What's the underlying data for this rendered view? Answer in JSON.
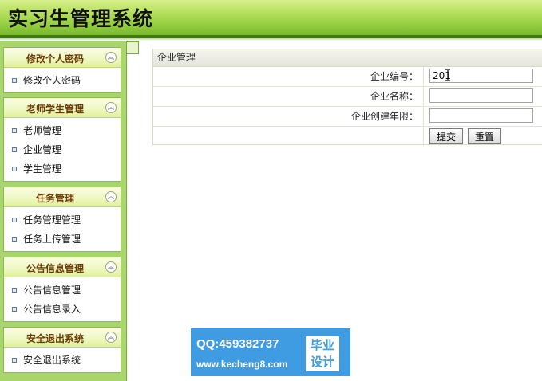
{
  "header": {
    "title": "实习生管理系统"
  },
  "sidebar": {
    "panels": [
      {
        "title": "修改个人密码",
        "items": [
          "修改个人密码"
        ]
      },
      {
        "title": "老师学生管理",
        "items": [
          "老师管理",
          "企业管理",
          "学生管理"
        ]
      },
      {
        "title": "任务管理",
        "items": [
          "任务管理管理",
          "任务上传管理"
        ]
      },
      {
        "title": "公告信息管理",
        "items": [
          "公告信息管理",
          "公告信息录入"
        ]
      },
      {
        "title": "安全退出系统",
        "items": [
          "安全退出系统"
        ]
      }
    ],
    "collapse_glyph": "︽"
  },
  "form": {
    "header": "企业管理",
    "fields": [
      {
        "label": "企业编号：",
        "value": "201"
      },
      {
        "label": "企业名称：",
        "value": ""
      },
      {
        "label": "企业创建年限：",
        "value": ""
      }
    ],
    "submit_label": "提交",
    "reset_label": "重置"
  },
  "watermark": {
    "qq": "QQ:459382737",
    "url": "www.kecheng8.com",
    "badge_line1": "毕业",
    "badge_line2": "设计"
  },
  "colors": {
    "header_green": "#8fcb3c",
    "header_border": "#3d7a12",
    "sidebar_green": "#a8d56c",
    "panel_title": "#6a3a05",
    "watermark_blue": "#3f9be2"
  }
}
